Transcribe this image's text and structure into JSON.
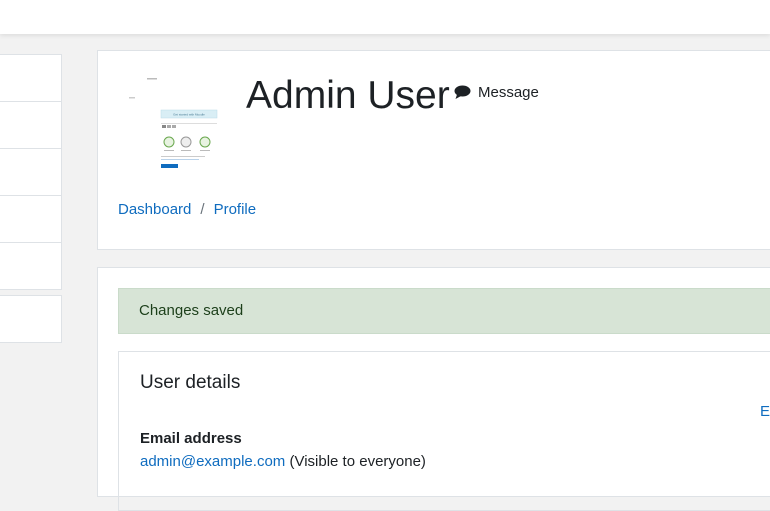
{
  "header": {
    "title": "Admin User",
    "message_label": "Message",
    "breadcrumb": [
      {
        "label": "Dashboard"
      },
      {
        "label": "Profile"
      }
    ]
  },
  "profile_image": {
    "headline": "Get started with Moodle"
  },
  "notice": {
    "text": "Changes saved",
    "color": "#d7e4d6"
  },
  "user_details": {
    "title": "User details",
    "edit_label": "E",
    "email_label": "Email address",
    "email_value": "admin@example.com",
    "email_visibility": "(Visible to everyone)"
  },
  "colors": {
    "link": "#0f6cbf",
    "text": "#1d2125",
    "background": "#f2f2f2"
  },
  "icons": {
    "message": "speech-bubble-icon"
  }
}
